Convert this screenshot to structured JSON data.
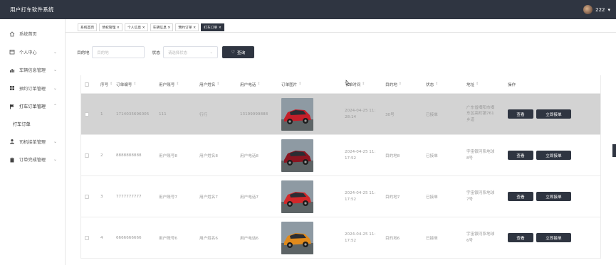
{
  "app": {
    "title": "用户打车软件系统"
  },
  "user": {
    "name": "222"
  },
  "sidebar": {
    "items": [
      {
        "label": "系统首页"
      },
      {
        "label": "个人中心"
      },
      {
        "label": "车辆信息管理"
      },
      {
        "label": "预约订单管理"
      },
      {
        "label": "打车订单管理"
      },
      {
        "label": "司机接单管理"
      },
      {
        "label": "订单完成管理"
      }
    ],
    "sub_item": "打车订单"
  },
  "tabs": [
    {
      "label": "系统首页"
    },
    {
      "label": "债权管理 ×"
    },
    {
      "label": "个人信息 ×"
    },
    {
      "label": "车辆信息 ×"
    },
    {
      "label": "预约订单 ×"
    },
    {
      "label": "打车订单 ×",
      "active": true
    }
  ],
  "search": {
    "dest_label": "目的地",
    "dest_placeholder": "目的地",
    "status_label": "状态",
    "status_placeholder": "请选择状态",
    "query_label": "查询"
  },
  "table": {
    "headers": [
      "序号",
      "订单编号",
      "用户账号",
      "用户姓名",
      "用户电话",
      "订单图片",
      "下单时间",
      "目的地",
      "状态",
      "地址",
      "操作"
    ],
    "rows": [
      {
        "index": "1",
        "order_no": "1714035696005",
        "account": "111",
        "name": "行行",
        "phone": "13199999888",
        "time_line1": "2024-04-25 11:",
        "time_line2": "28:14",
        "dest": "30号",
        "status": "已接单",
        "addr_lines": [
          "广东省揭阳市揭",
          "东区高町镇761",
          "乡道"
        ],
        "car_color": "#c41f2a"
      },
      {
        "index": "2",
        "order_no": "8888888888",
        "account": "用户账号8",
        "name": "用户姓名8",
        "phone": "用户电话8",
        "time_line1": "2024-04-25 11:",
        "time_line2": "17:52",
        "dest": "目的地8",
        "status": "已接单",
        "addr_lines": [
          "宇宙银河系地球",
          "8号"
        ],
        "car_color": "#8a1420"
      },
      {
        "index": "3",
        "order_no": "7777777777",
        "account": "用户账号7",
        "name": "用户姓名7",
        "phone": "用户电话7",
        "time_line1": "2024-04-25 11:",
        "time_line2": "17:52",
        "dest": "目的地7",
        "status": "已接单",
        "addr_lines": [
          "宇宙银河系地球",
          "7号"
        ],
        "car_color": "#d2282a"
      },
      {
        "index": "4",
        "order_no": "6666666666",
        "account": "用户账号6",
        "name": "用户姓名6",
        "phone": "用户电话6",
        "time_line1": "2024-04-25 11:",
        "time_line2": "17:52",
        "dest": "目的地6",
        "status": "已接单",
        "addr_lines": [
          "宇宙银河系地球",
          "6号"
        ],
        "car_color": "#e08a1c"
      }
    ],
    "view_label": "查看",
    "accept_label": "立即接单"
  },
  "colors": {
    "topbar": "#2f3541",
    "button": "#2f3541",
    "row_highlight": "#d3d3d3"
  }
}
